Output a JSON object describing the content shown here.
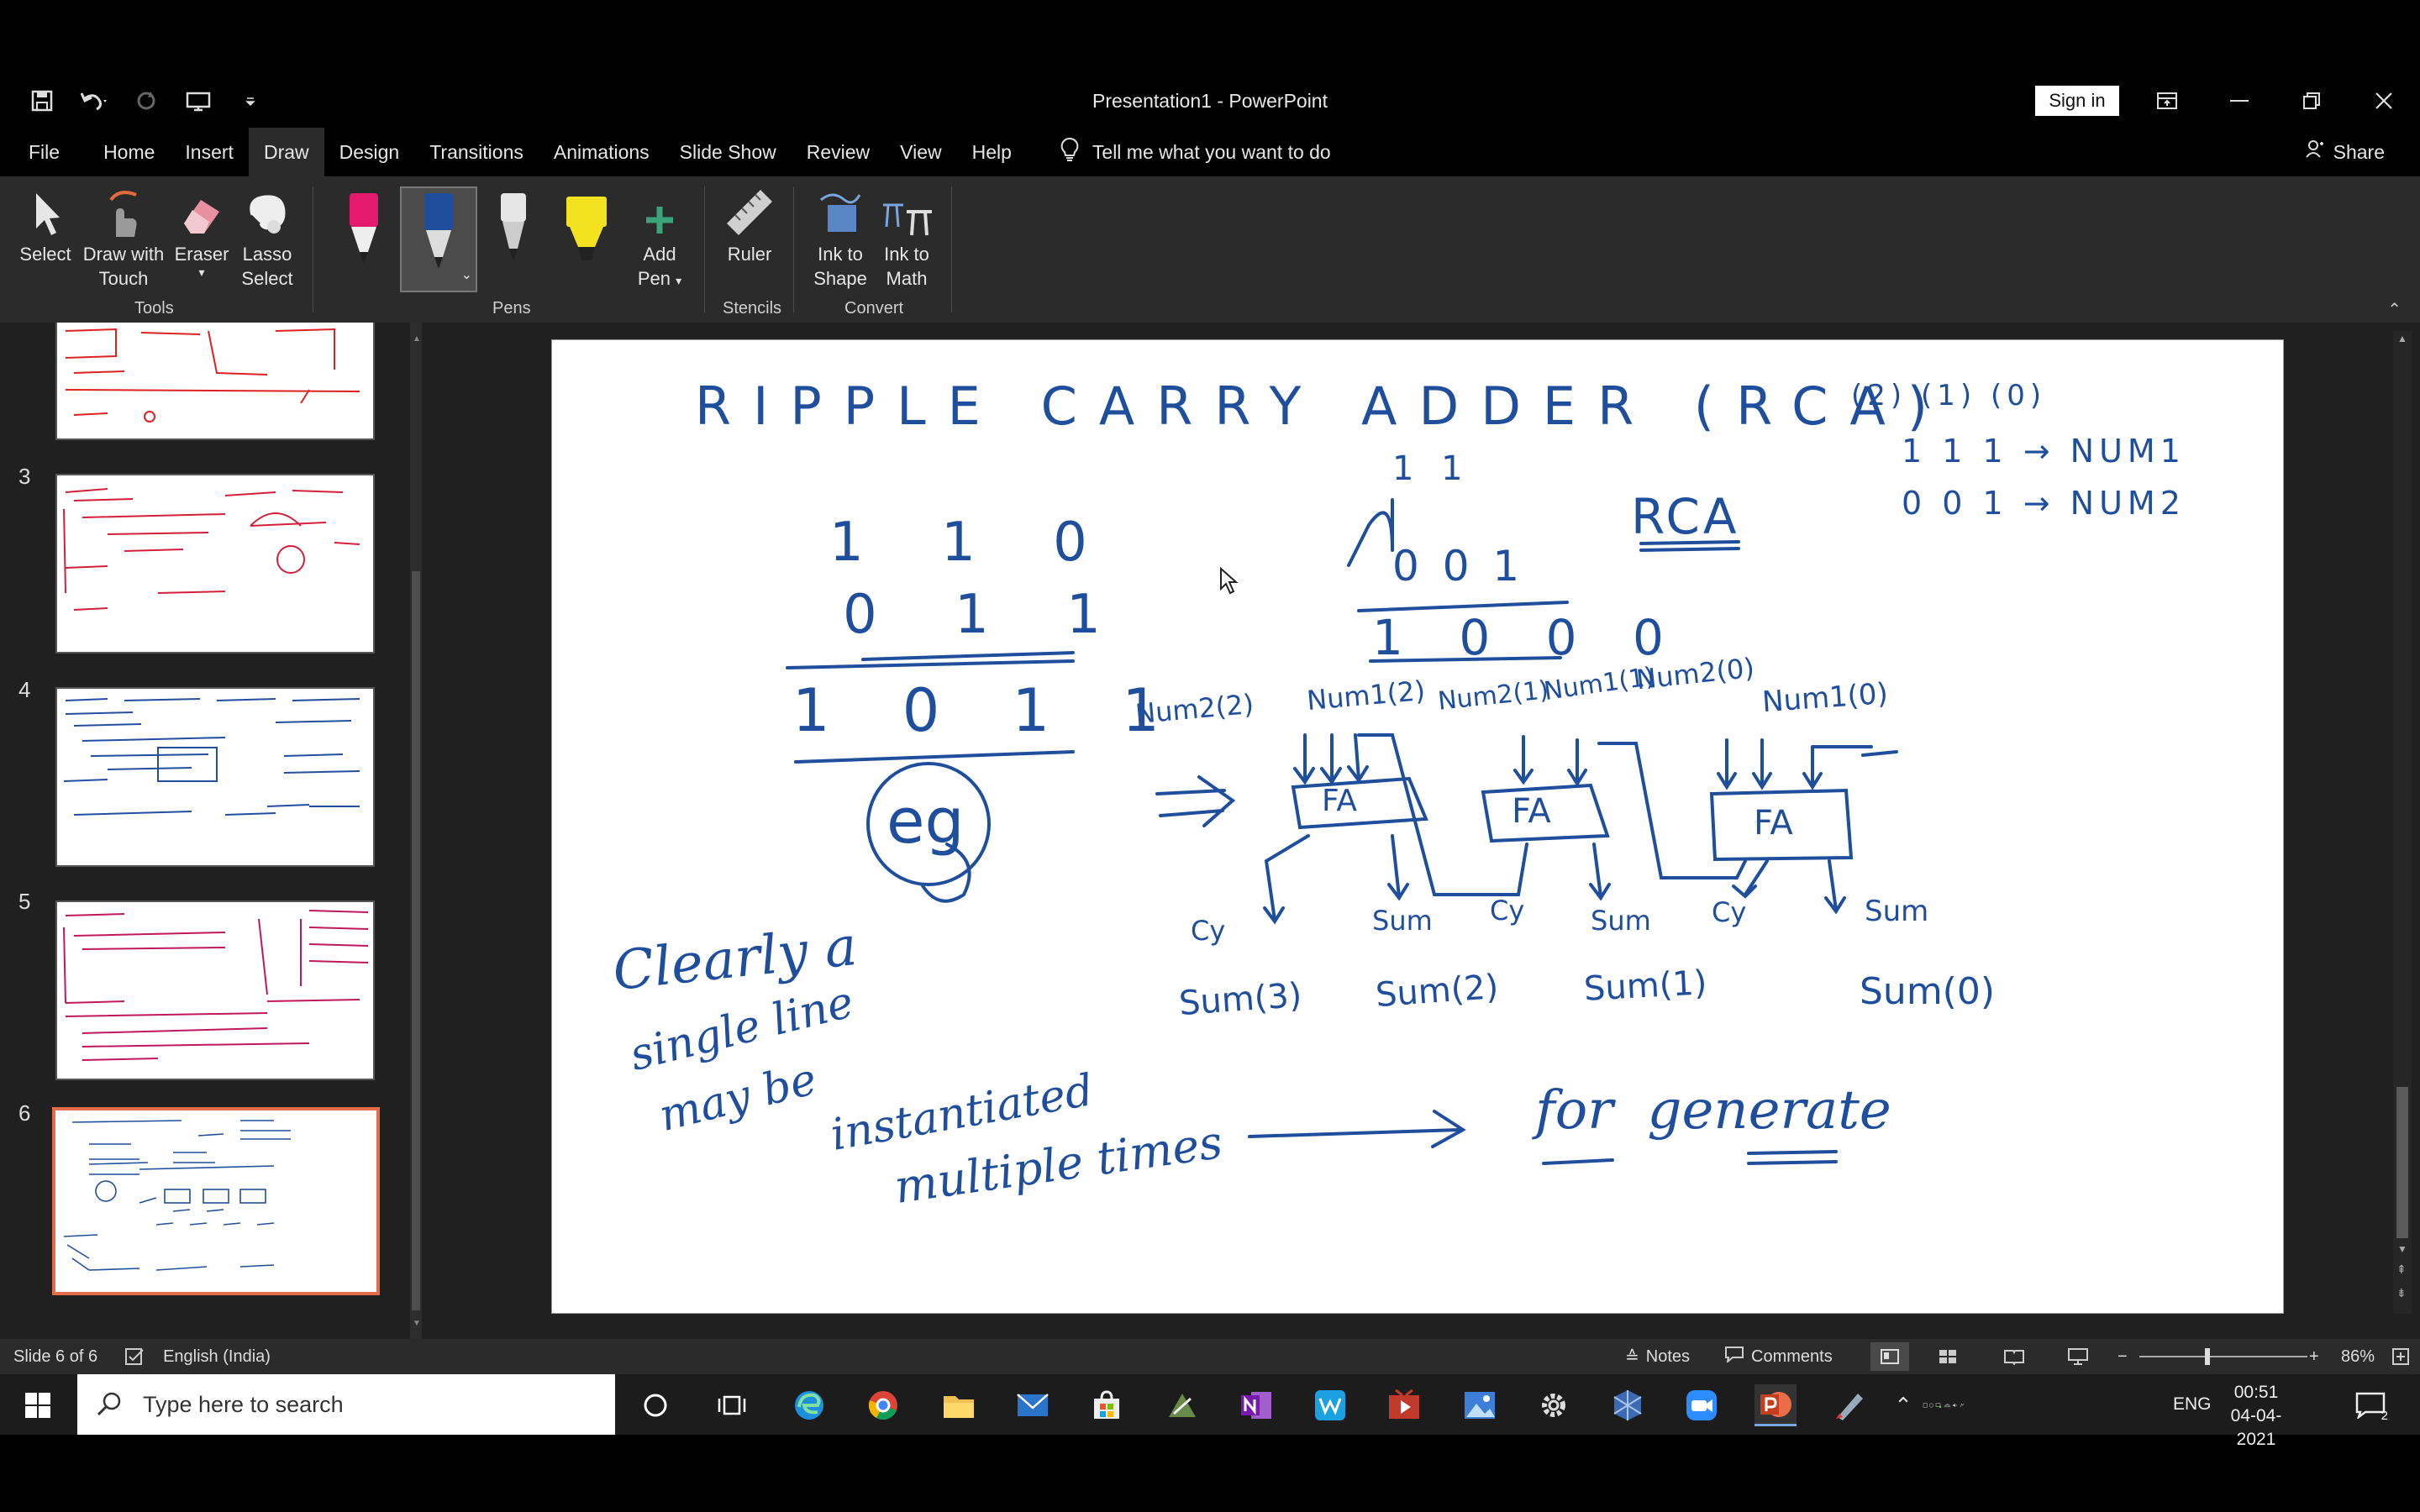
{
  "window": {
    "title": "Presentation1  -  PowerPoint",
    "sign_in": "Sign in"
  },
  "menu": {
    "file": "File",
    "tabs": [
      "Home",
      "Insert",
      "Draw",
      "Design",
      "Transitions",
      "Animations",
      "Slide Show",
      "Review",
      "View",
      "Help"
    ],
    "tell_me": "Tell me what you want to do",
    "share": "Share"
  },
  "ribbon": {
    "tools": {
      "select": "Select",
      "draw_touch_1": "Draw with",
      "draw_touch_2": "Touch",
      "eraser": "Eraser",
      "lasso_1": "Lasso",
      "lasso_2": "Select",
      "label": "Tools"
    },
    "pens": {
      "add_pen_1": "Add",
      "add_pen_2": "Pen",
      "label": "Pens"
    },
    "stencils": {
      "ruler": "Ruler",
      "label": "Stencils"
    },
    "convert": {
      "ink_shape_1": "Ink to",
      "ink_shape_2": "Shape",
      "ink_math_1": "Ink to",
      "ink_math_2": "Math",
      "label": "Convert"
    },
    "pen_colors": [
      "#e5196e",
      "#1f4f9c",
      "#ffffff",
      "#f3e21f"
    ]
  },
  "thumbnails": {
    "numbers": [
      "3",
      "4",
      "5",
      "6"
    ],
    "selected": "6"
  },
  "slide": {
    "title": "RIPPLE CARRY ADDER (RCA)",
    "indices": "(2) (1) (0)",
    "num1": "1 1 1 → NUM1",
    "num2": "0 0 1 → NUM2",
    "rca": "RCA",
    "carry_top": "1 1",
    "add_a": "1 1 0",
    "add_b": "0 1 1",
    "add_sum": "1 0 1 1",
    "eg": "eg",
    "add2_a": "0 0 1",
    "add2_sum": "1 0 0 0",
    "labels": [
      "Num2(2)",
      "Num1(2)",
      "Num2(1)",
      "Num1(1)",
      "Num2(0)",
      "Num1(0)"
    ],
    "fa": "FA",
    "cy": "Cy",
    "sum": "Sum",
    "sums": [
      "Sum(3)",
      "Sum(2)",
      "Sum(1)",
      "Sum(0)"
    ],
    "note1": "Clearly a",
    "note2": "single line",
    "note3": "may be",
    "note4": "instantiated",
    "note5": "multiple times",
    "for_generate": "for  generate"
  },
  "status": {
    "slide": "Slide 6 of 6",
    "language": "English (India)",
    "notes": "Notes",
    "comments": "Comments",
    "zoom": "86%"
  },
  "taskbar": {
    "search_placeholder": "Type here to search",
    "lang": "ENG",
    "time": "00:51",
    "date": "04-04-2021",
    "notif": "2"
  }
}
